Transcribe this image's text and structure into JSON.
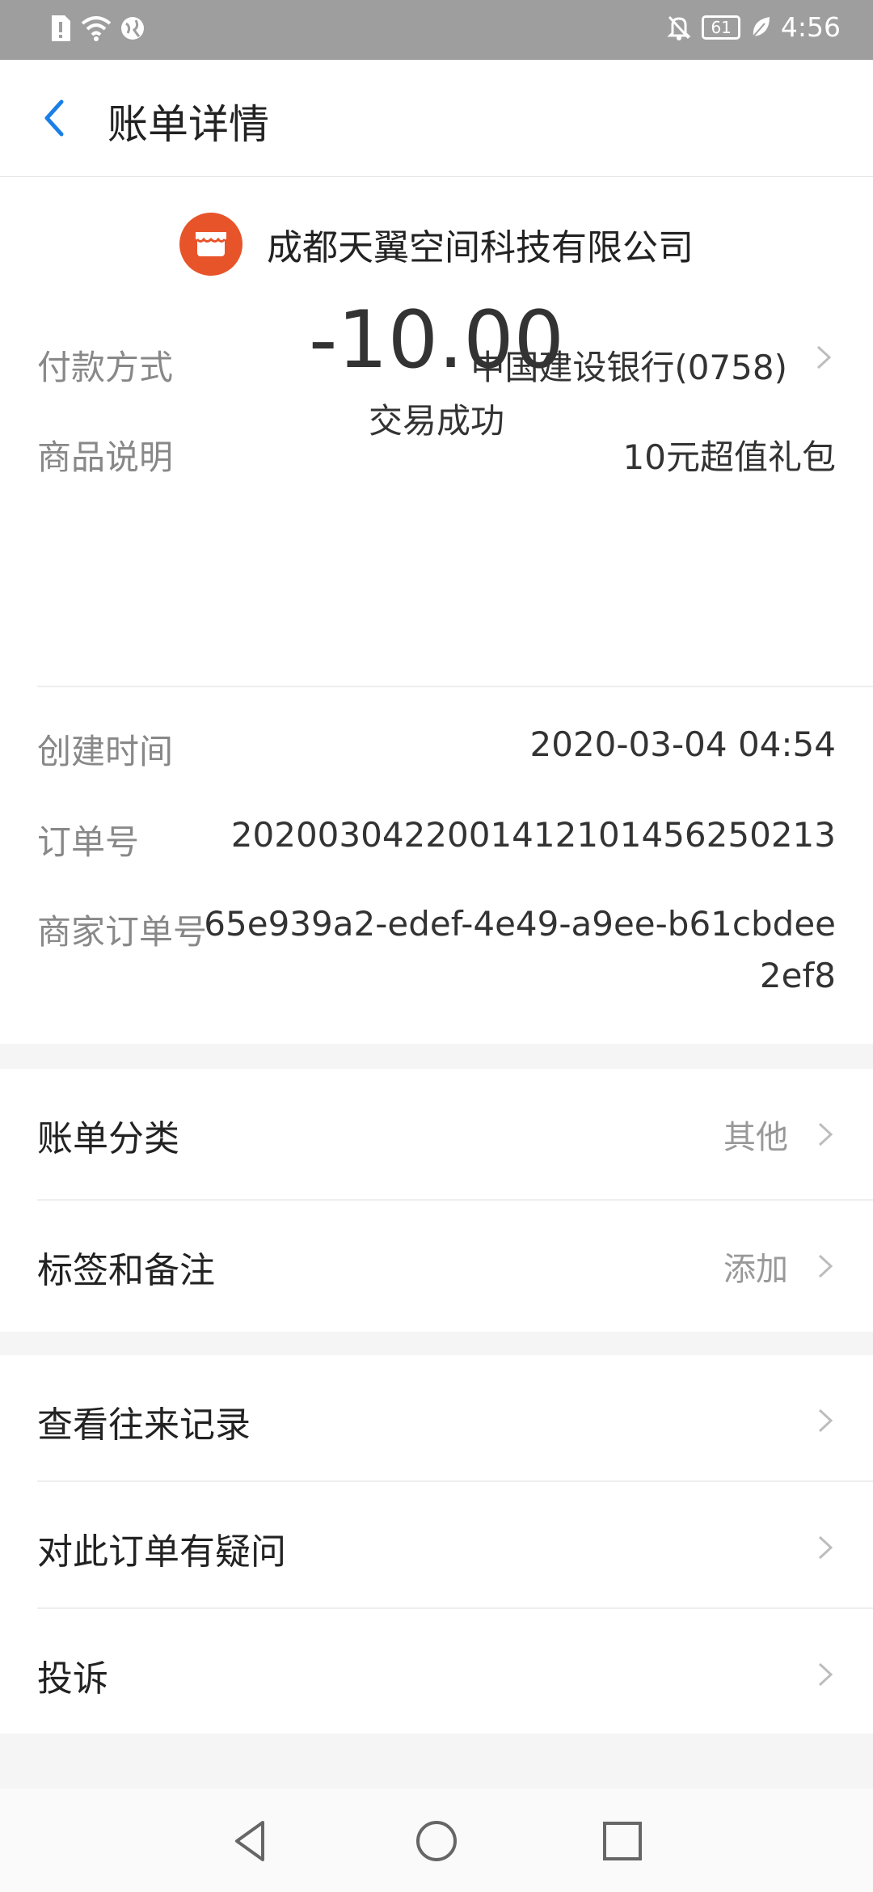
{
  "status_bar": {
    "time": "4:56",
    "battery": "61",
    "left_icons": [
      "sim-alert-icon",
      "wifi-icon",
      "globe-icon"
    ],
    "right_icons": [
      "notifications-off-icon",
      "battery-icon",
      "leaf-icon"
    ]
  },
  "header": {
    "title": "账单详情",
    "back_icon": "chevron-left-icon"
  },
  "summary": {
    "merchant_name": "成都天翼空间科技有限公司",
    "merchant_icon": "store-icon",
    "amount": "-10.00",
    "status": "交易成功"
  },
  "details": {
    "payment_method_label": "付款方式",
    "payment_method_value": "中国建设银行(0758)",
    "product_label": "商品说明",
    "product_value": "10元超值礼包",
    "created_label": "创建时间",
    "created_value": "2020-03-04 04:54",
    "order_no_label": "订单号",
    "order_no_value": "2020030422001412101456250213",
    "merchant_order_label": "商家订单号",
    "merchant_order_line1": "65e939a2-edef-4e49-a9ee-b61cbdee",
    "merchant_order_line2": "2ef8"
  },
  "category": {
    "label": "账单分类",
    "value": "其他"
  },
  "tags": {
    "label": "标签和备注",
    "value": "添加"
  },
  "actions": {
    "history": "查看往来记录",
    "question": "对此订单有疑问",
    "complaint": "投诉"
  },
  "colors": {
    "accent_blue": "#1a7fe6",
    "merchant_orange": "#e8542a",
    "status_bar_gray": "#9e9e9e"
  }
}
